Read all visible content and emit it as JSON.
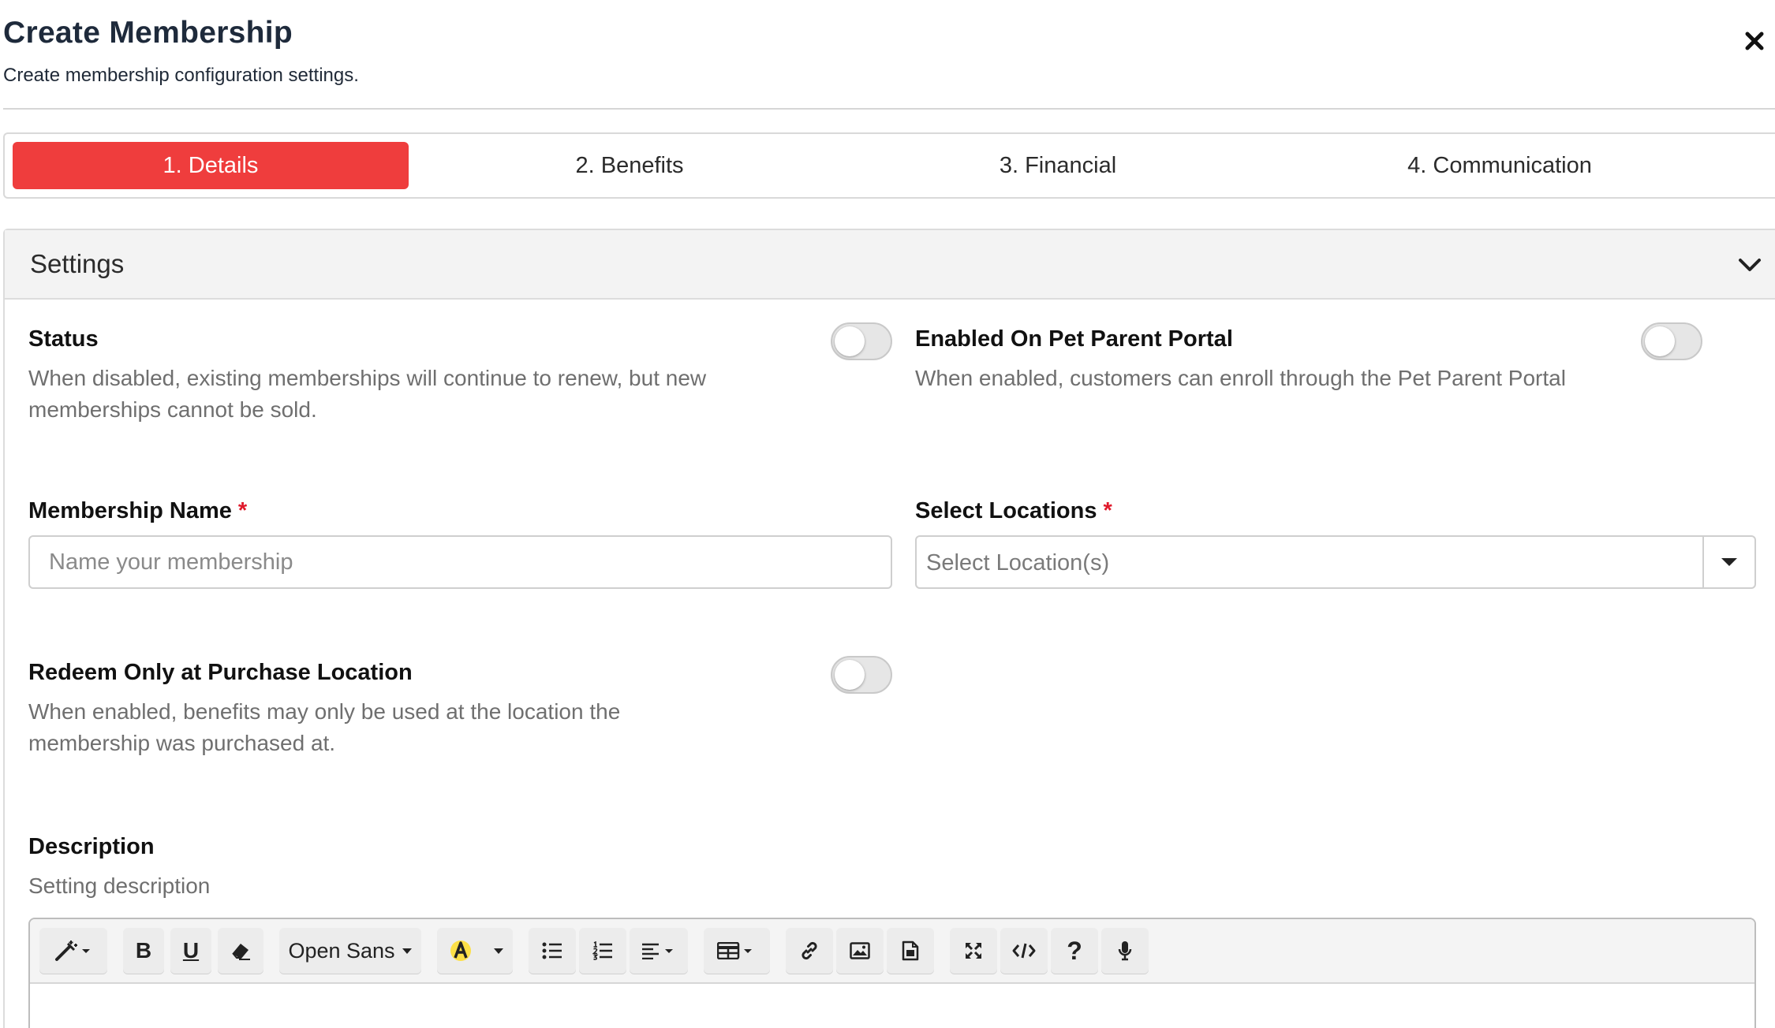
{
  "header": {
    "title": "Create Membership",
    "subtitle": "Create membership configuration settings.",
    "close_icon": "close-icon"
  },
  "tabs": [
    {
      "label": "1. Details",
      "active": true
    },
    {
      "label": "2. Benefits",
      "active": false
    },
    {
      "label": "3. Financial",
      "active": false
    },
    {
      "label": "4. Communication",
      "active": false
    }
  ],
  "settings": {
    "title": "Settings",
    "status": {
      "label": "Status",
      "description": "When disabled, existing memberships will continue to renew, but new memberships cannot be sold.",
      "enabled": false
    },
    "pet_parent_portal": {
      "label": "Enabled On Pet Parent Portal",
      "description": "When enabled, customers can enroll through the Pet Parent Portal",
      "enabled": false
    },
    "membership_name": {
      "label": "Membership Name",
      "required_mark": "*",
      "placeholder": "Name your membership",
      "value": ""
    },
    "locations": {
      "label": "Select Locations",
      "required_mark": "*",
      "placeholder": "Select Location(s)"
    },
    "redeem_only": {
      "label": "Redeem Only at Purchase Location",
      "description": "When enabled, benefits may only be used at the location the membership was purchased at.",
      "enabled": false
    },
    "description": {
      "label": "Description",
      "help": "Setting description"
    }
  },
  "editor": {
    "font": "Open Sans",
    "toolbar_icons": [
      "magic-wand-icon",
      "bold-icon",
      "underline-icon",
      "eraser-icon",
      "font-family-dropdown",
      "highlight-color-icon",
      "bullet-list-icon",
      "numbered-list-icon",
      "align-icon",
      "table-icon",
      "link-icon",
      "image-icon",
      "file-icon",
      "fullscreen-icon",
      "code-view-icon",
      "help-icon",
      "microphone-icon"
    ],
    "bold_glyph": "B",
    "underline_glyph": "U",
    "help_glyph": "?",
    "highlight_color": "#fde047"
  },
  "colors": {
    "accent": "#ef3d3d",
    "required": "#e0192b"
  }
}
